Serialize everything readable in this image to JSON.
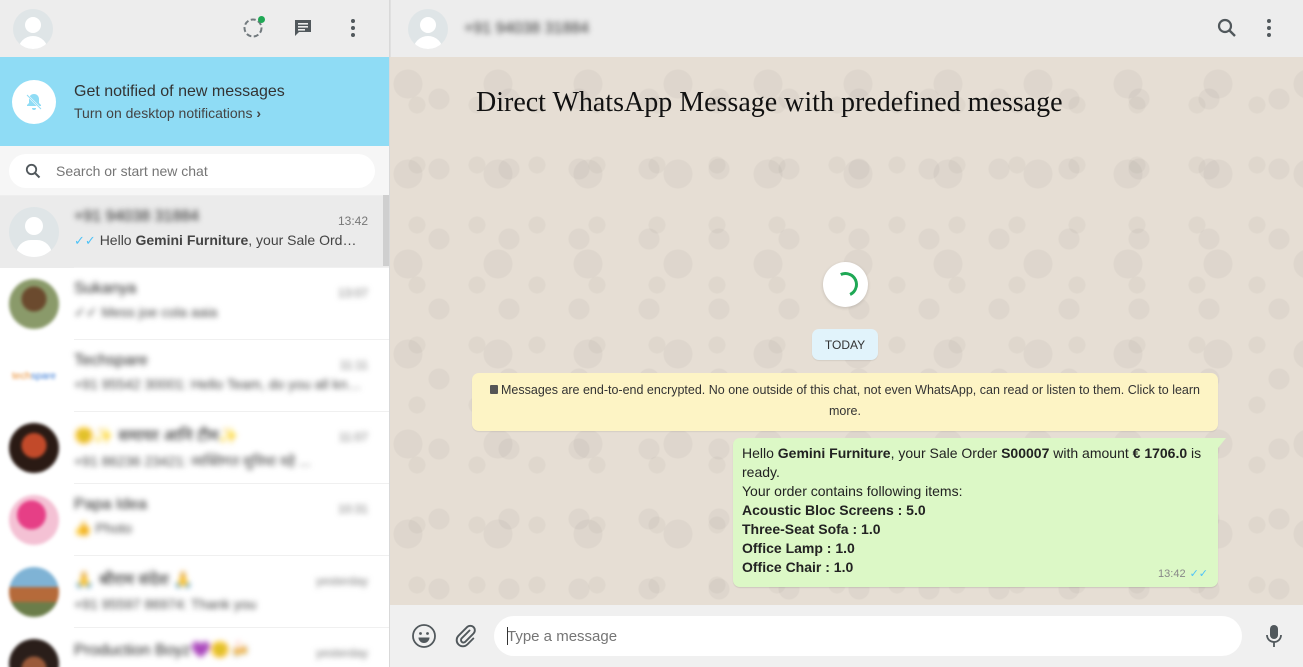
{
  "notification": {
    "title": "Get notified of new messages",
    "subtitle": "Turn on desktop notifications"
  },
  "search": {
    "placeholder": "Search or start new chat"
  },
  "chats": [
    {
      "name": "+91 94038 31884",
      "time": "13:42",
      "preview_prefix": "Hello ",
      "preview_bold": "Gemini Furniture",
      "preview_suffix": ", your Sale Orde…",
      "blurred": false
    },
    {
      "name": "Sukanya",
      "time": "13:07",
      "preview": "✓✓ Mess joe cola aaia",
      "blurred": true
    },
    {
      "name": "Techspare",
      "time": "11:11",
      "preview": "+91 95542 30001: Hello Team, do you all kno...",
      "blurred": true
    },
    {
      "name": "🙂✨ समायर आनि टीम✨",
      "time": "11:07",
      "preview": "+91 86236 23421: व्यक्तिगत सुविधा वहे ...",
      "blurred": true
    },
    {
      "name": "Papa Idea",
      "time": "10:31",
      "preview": "👍 Photo",
      "blurred": true
    },
    {
      "name": "🙏 श्रीराम संदेश 🙏",
      "time": "yesterday",
      "preview": "+91 95597 86974: Thank you",
      "blurred": true
    },
    {
      "name": "Production Boyz💜🙂🍻",
      "time": "yesterday",
      "preview": "",
      "blurred": true
    }
  ],
  "conversation": {
    "contact": "+91 94038 31884",
    "overlay_title": "Direct WhatsApp Message with predefined message",
    "date_chip": "TODAY",
    "encryption_notice": "Messages are end-to-end encrypted. No one outside of this chat, not even WhatsApp, can read or listen to them. Click to learn more.",
    "message": {
      "greet": "Hello ",
      "company": "Gemini Furniture",
      "mid1": ", your Sale Order ",
      "order": "S00007",
      "mid2": " with amount ",
      "amount": "€ 1706.0",
      "tail": " is ready.",
      "items_intro": "Your order contains following items:",
      "items": [
        "Acoustic Bloc Screens : 5.0",
        "Three-Seat Sofa : 1.0",
        "Office Lamp : 1.0",
        "Office Chair : 1.0"
      ],
      "time": "13:42"
    }
  },
  "composer": {
    "placeholder": "Type a message"
  },
  "colors": {
    "accent": "#1fa855",
    "banner": "#8fdcf5",
    "outgoing": "#dcf8c6",
    "tick": "#4fc3f7"
  }
}
